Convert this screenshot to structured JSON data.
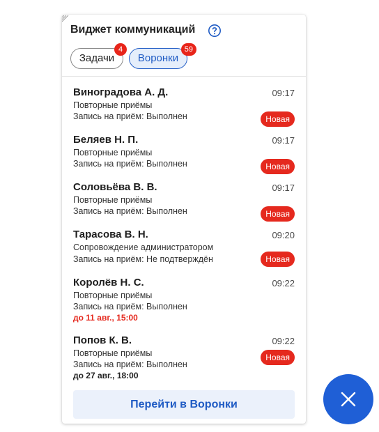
{
  "widget": {
    "title": "Виджет коммуникаций",
    "tabs": [
      {
        "label": "Задачи",
        "count": "4",
        "active": false
      },
      {
        "label": "Воронки",
        "count": "59",
        "active": true
      }
    ],
    "items": [
      {
        "name": "Виноградова А. Д.",
        "time": "09:17",
        "line1": "Повторные приёмы",
        "line2": "Запись на приём: Выполнен",
        "status": "Новая",
        "deadline": ""
      },
      {
        "name": "Беляев Н. П.",
        "time": "09:17",
        "line1": "Повторные приёмы",
        "line2": "Запись на приём: Выполнен",
        "status": "Новая",
        "deadline": ""
      },
      {
        "name": "Соловьёва В. В.",
        "time": "09:17",
        "line1": "Повторные приёмы",
        "line2": "Запись на приём: Выполнен",
        "status": "Новая",
        "deadline": ""
      },
      {
        "name": "Тарасова В. Н.",
        "time": "09:20",
        "line1": "Сопровождение администратором",
        "line2": "Запись на приём: Не подтверждён",
        "status": "Новая",
        "deadline": ""
      },
      {
        "name": "Королёв Н. С.",
        "time": "09:22",
        "line1": "Повторные приёмы",
        "line2": "Запись на приём: Выполнен",
        "status": "",
        "deadline": "до 11 авг., 15:00",
        "deadline_color": "#e5291e"
      },
      {
        "name": "Попов К. В.",
        "time": "09:22",
        "line1": "Повторные приёмы",
        "line2": "Запись на приём: Выполнен",
        "status": "Новая",
        "deadline": "до 27 авг., 18:00",
        "deadline_color": "#222222"
      }
    ],
    "cta_label": "Перейти в Воронки"
  },
  "icons": {
    "help": "help-circle-icon",
    "close": "close-icon",
    "resize": "resize-grip-icon"
  },
  "colors": {
    "accent": "#1f5fd6",
    "badge": "#e8251a",
    "status_new": "#e5291e",
    "overdue": "#e5291e"
  }
}
